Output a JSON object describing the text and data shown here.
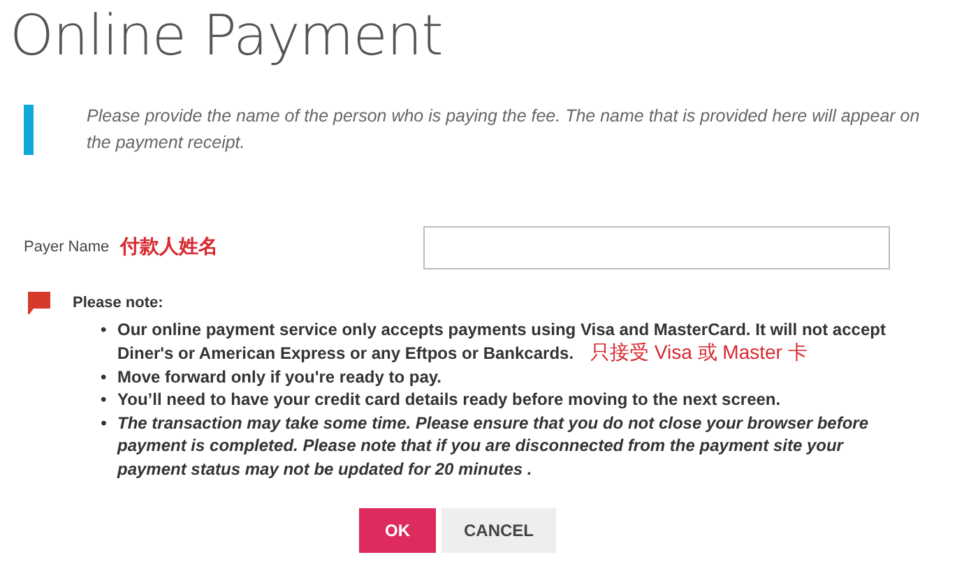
{
  "page_title": "Online Payment",
  "intro": "Please provide the name of the person who is paying the fee. The name that is provided here will appear on the payment receipt.",
  "payer": {
    "label": "Payer Name",
    "annotation": "付款人姓名"
  },
  "note": {
    "heading": "Please note:",
    "bullet": "•",
    "items": [
      {
        "kind": "bold",
        "text": "Our online payment service only accepts payments using Visa and MasterCard. It will not accept Diner's or American Express or any Eftpos or Bankcards.",
        "annotation": "只接受 Visa 或 Master 卡"
      },
      {
        "kind": "bold",
        "text": "Move forward only if you're ready to pay."
      },
      {
        "kind": "bold",
        "text": "You’ll need to have your credit card details ready before moving to the next screen."
      },
      {
        "kind": "italic",
        "text": "The transaction may take some time. Please ensure that you do not close your browser before payment is completed. Please note that if you are disconnected from the payment site your payment status may not be updated for 20 minutes ."
      }
    ]
  },
  "buttons": [
    {
      "label": "OK",
      "kind": "primary"
    },
    {
      "label": "CANCEL",
      "kind": "secondary"
    }
  ]
}
